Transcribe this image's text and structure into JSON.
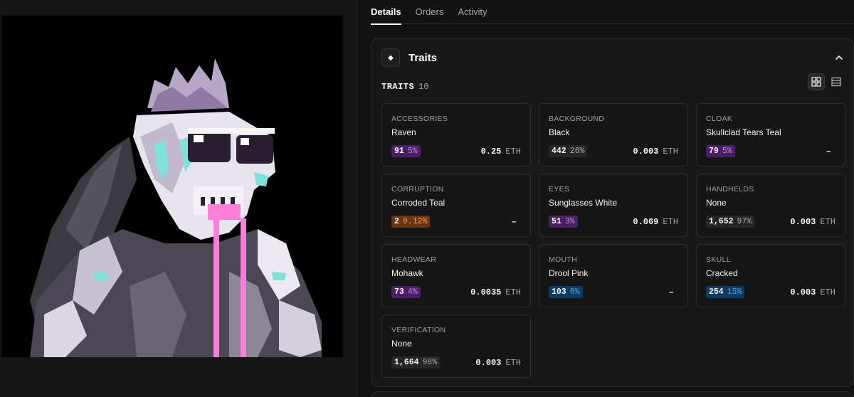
{
  "tabs": [
    {
      "label": "Details",
      "active": true
    },
    {
      "label": "Orders",
      "active": false
    },
    {
      "label": "Activity",
      "active": false
    }
  ],
  "traits_section": {
    "title": "Traits",
    "icon": "diamond-icon",
    "count_label": "TRAITS",
    "count": "10",
    "items": [
      {
        "type": "ACCESSORIES",
        "value": "Raven",
        "count": "91",
        "pct": "5%",
        "price": "0.25",
        "unit": "ETH",
        "rarity": "purple"
      },
      {
        "type": "BACKGROUND",
        "value": "Black",
        "count": "442",
        "pct": "26%",
        "price": "0.003",
        "unit": "ETH",
        "rarity": "gray"
      },
      {
        "type": "CLOAK",
        "value": "Skullclad Tears Teal",
        "count": "79",
        "pct": "5%",
        "price": "–",
        "unit": "",
        "rarity": "purple"
      },
      {
        "type": "CORRUPTION",
        "value": "Corroded Teal",
        "count": "2",
        "pct": "0.12%",
        "price": "–",
        "unit": "",
        "rarity": "orange"
      },
      {
        "type": "EYES",
        "value": "Sunglasses White",
        "count": "51",
        "pct": "3%",
        "price": "0.069",
        "unit": "ETH",
        "rarity": "purple"
      },
      {
        "type": "HANDHELDS",
        "value": "None",
        "count": "1,652",
        "pct": "97%",
        "price": "0.003",
        "unit": "ETH",
        "rarity": "gray"
      },
      {
        "type": "HEADWEAR",
        "value": "Mohawk",
        "count": "73",
        "pct": "4%",
        "price": "0.0035",
        "unit": "ETH",
        "rarity": "purple"
      },
      {
        "type": "MOUTH",
        "value": "Drool Pink",
        "count": "103",
        "pct": "6%",
        "price": "–",
        "unit": "",
        "rarity": "blue"
      },
      {
        "type": "SKULL",
        "value": "Cracked",
        "count": "254",
        "pct": "15%",
        "price": "0.003",
        "unit": "ETH",
        "rarity": "blue"
      },
      {
        "type": "VERIFICATION",
        "value": "None",
        "count": "1,664",
        "pct": "98%",
        "price": "0.003",
        "unit": "ETH",
        "rarity": "gray"
      }
    ]
  },
  "colors": {
    "background": "#121212",
    "card": "#181818",
    "purple_badge": "#4a1f63",
    "blue_badge": "#0f3b63",
    "orange_badge": "#6a3611",
    "gray_badge": "#262626"
  }
}
